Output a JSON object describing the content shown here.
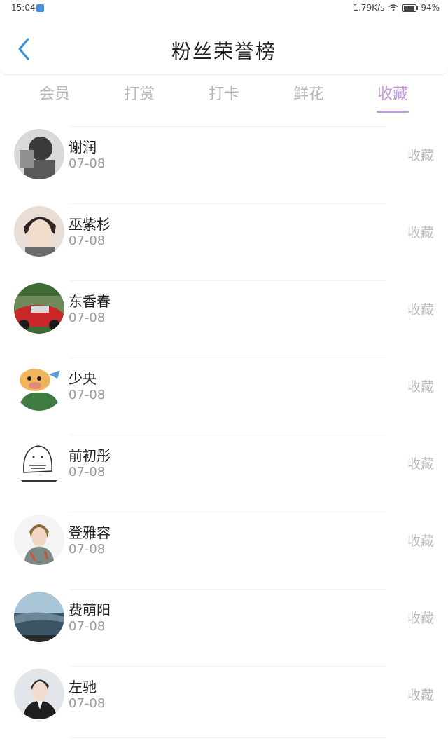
{
  "status": {
    "time": "15:04",
    "speed": "1.79K/s",
    "battery": "94%",
    "battery_level": 0.94
  },
  "header": {
    "title": "粉丝荣誉榜",
    "back_icon": "chevron-left-icon",
    "accent": "#3d8fd6"
  },
  "tabs": [
    {
      "label": "会员",
      "active": false
    },
    {
      "label": "打赏",
      "active": false
    },
    {
      "label": "打卡",
      "active": false
    },
    {
      "label": "鲜花",
      "active": false
    },
    {
      "label": "收藏",
      "active": true
    }
  ],
  "colors": {
    "tab_active": "#c39ad8",
    "tab_inactive": "#b8b8b8"
  },
  "fans": [
    {
      "name": "谢润",
      "date": "07-08",
      "action": "收藏"
    },
    {
      "name": "巫紫杉",
      "date": "07-08",
      "action": "收藏"
    },
    {
      "name": "东香春",
      "date": "07-08",
      "action": "收藏"
    },
    {
      "name": "少央",
      "date": "07-08",
      "action": "收藏"
    },
    {
      "name": "前初彤",
      "date": "07-08",
      "action": "收藏"
    },
    {
      "name": "登雅容",
      "date": "07-08",
      "action": "收藏"
    },
    {
      "name": "费萌阳",
      "date": "07-08",
      "action": "收藏"
    },
    {
      "name": "左驰",
      "date": "07-08",
      "action": "收藏"
    }
  ]
}
